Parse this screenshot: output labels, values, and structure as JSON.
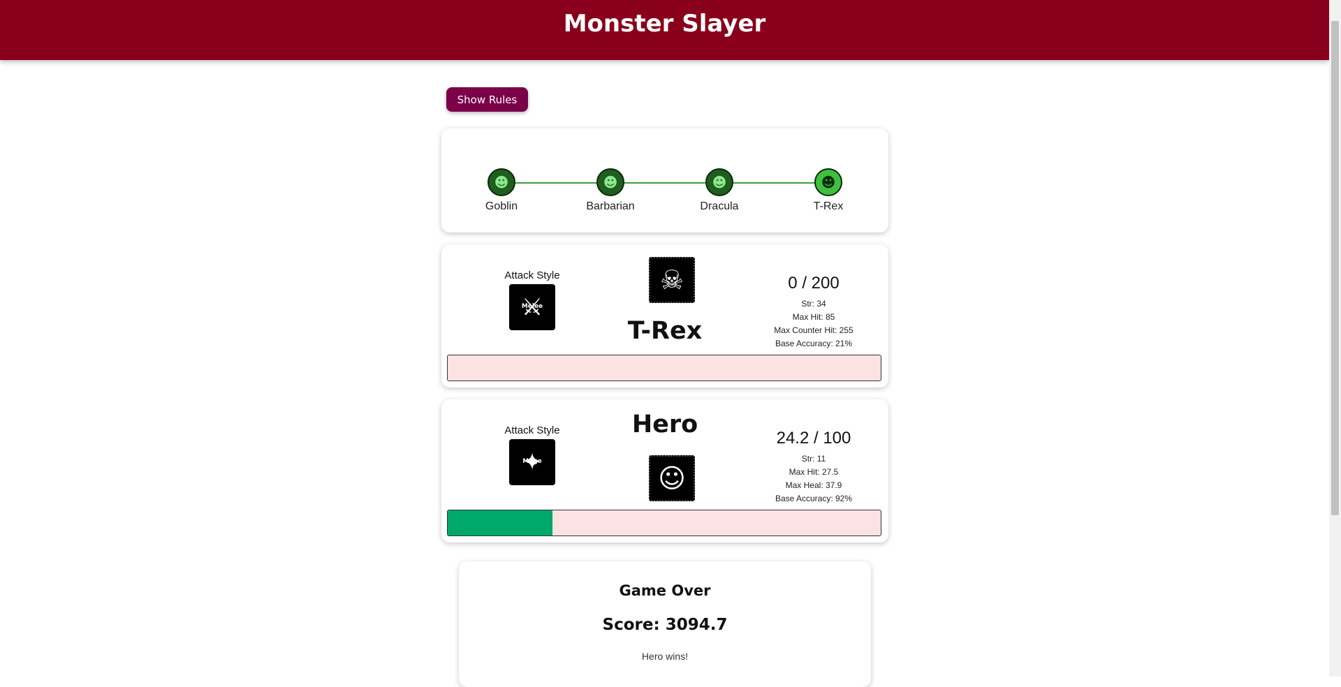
{
  "header": {
    "title": "Monster Slayer"
  },
  "rules_button": {
    "label": "Show Rules"
  },
  "progress": {
    "stages": [
      {
        "label": "Goblin",
        "icon": "goblin-icon",
        "current": false
      },
      {
        "label": "Barbarian",
        "icon": "barbarian-icon",
        "current": false
      },
      {
        "label": "Dracula",
        "icon": "dracula-icon",
        "current": false
      },
      {
        "label": "T-Rex",
        "icon": "trex-icon",
        "current": true
      }
    ],
    "colors": {
      "track": "#3aa13a",
      "node": "#1e5e1e",
      "node_current": "#3fbf3f"
    }
  },
  "monster": {
    "attack_style_title": "Attack Style",
    "attack_style_tag": "Melee",
    "attack_style_icon": "melee-icon",
    "name": "T-Rex",
    "portrait_icon": "trex-portrait-icon",
    "hp": "0 / 200",
    "stats": {
      "str": "Str: 34",
      "max_hit": "Max Hit: 85",
      "max_counter_hit": "Max Counter Hit: 255",
      "base_accuracy": "Base Accuracy: 21%"
    },
    "health_fraction": 0.0
  },
  "hero": {
    "attack_style_title": "Attack Style",
    "attack_style_tag": "Mage",
    "attack_style_icon": "mage-icon",
    "name": "Hero",
    "portrait_icon": "hero-portrait-icon",
    "hp": "24.2 / 100",
    "stats": {
      "str": "Str: 11",
      "max_hit": "Max Hit: 27.5",
      "max_heal": "Max Heal: 37.9",
      "base_accuracy": "Base Accuracy: 92%"
    },
    "health_fraction": 0.242
  },
  "result": {
    "title": "Game Over",
    "score": "Score: 3094.7",
    "message": "Hero wins!"
  },
  "colors": {
    "header_bg": "#88001b",
    "button_bg": "#7a0049",
    "hp_fill": "#00a86b",
    "hp_empty": "#fde2e4"
  }
}
